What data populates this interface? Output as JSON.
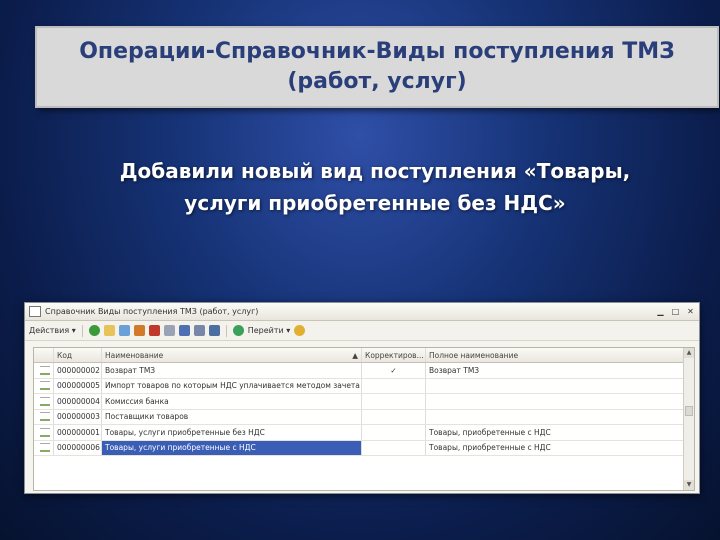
{
  "slide": {
    "title_line1": "Операции-Справочник-Виды поступления ТМЗ",
    "title_line2": "(работ, услуг)",
    "subtitle_line1": "Добавили новый вид поступления «Товары,",
    "subtitle_line2": "услуги приобретенные без НДС»"
  },
  "window": {
    "title": "Справочник Виды поступления ТМЗ (работ, услуг)",
    "toolbar": {
      "actions_label": "Действия",
      "goto_label": "Перейти"
    },
    "columns": [
      "Код",
      "Наименование",
      "Корректиров...",
      "Полное наименование"
    ],
    "rows": [
      {
        "code": "000000002",
        "name": "Возврат ТМЗ",
        "corr": "✓",
        "full": "Возврат ТМЗ",
        "selected": false
      },
      {
        "code": "000000005",
        "name": "Импорт товаров по которым НДС уплачивается методом зачета",
        "corr": "",
        "full": "",
        "selected": false
      },
      {
        "code": "000000004",
        "name": "Комиссия банка",
        "corr": "",
        "full": "",
        "selected": false
      },
      {
        "code": "000000003",
        "name": "Поставщики товаров",
        "corr": "",
        "full": "",
        "selected": false
      },
      {
        "code": "000000001",
        "name": "Товары, услуги приобретенные без НДС",
        "corr": "",
        "full": "Товары, приобретенные с НДС",
        "selected": false
      },
      {
        "code": "000000006",
        "name": "Товары, услуги приобретенные с НДС",
        "corr": "",
        "full": "Товары, приобретенные с НДС",
        "selected": true
      }
    ]
  }
}
